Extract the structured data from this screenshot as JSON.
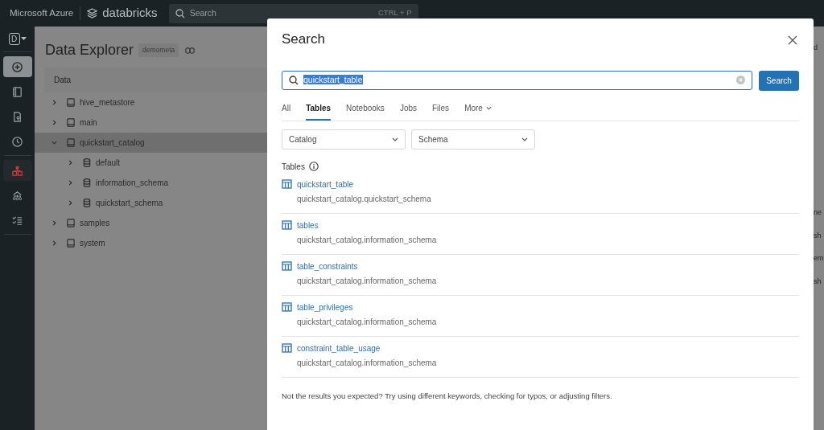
{
  "topbar": {
    "brand": "Microsoft Azure",
    "product": "databricks",
    "search": {
      "placeholder": "Search",
      "shortcut": "CTRL + P"
    }
  },
  "sidebar": {
    "workspace": "D",
    "items": [
      {
        "kind": "new",
        "selected": false
      },
      {
        "kind": "workspace",
        "selected": false
      },
      {
        "kind": "repos",
        "selected": false
      },
      {
        "kind": "recents",
        "selected": false
      },
      {
        "kind": "catalog",
        "selected": true
      },
      {
        "kind": "workflows",
        "selected": false
      },
      {
        "kind": "jobs",
        "selected": false
      }
    ]
  },
  "explorer": {
    "title": "Data Explorer",
    "badge": "demometa",
    "header": "Data",
    "tree": [
      {
        "label": "hive_metastore",
        "kind": "catalog",
        "expanded": false,
        "selected": false
      },
      {
        "label": "main",
        "kind": "catalog",
        "expanded": false,
        "selected": false
      },
      {
        "label": "quickstart_catalog",
        "kind": "catalog",
        "expanded": true,
        "selected": true,
        "children": [
          {
            "label": "default",
            "kind": "schema",
            "expanded": false,
            "selected": false
          },
          {
            "label": "information_schema",
            "kind": "schema",
            "expanded": false,
            "selected": false
          },
          {
            "label": "quickstart_schema",
            "kind": "schema",
            "expanded": false,
            "selected": false
          }
        ]
      },
      {
        "label": "samples",
        "kind": "catalog",
        "expanded": false,
        "selected": false
      },
      {
        "label": "system",
        "kind": "catalog",
        "expanded": false,
        "selected": false
      }
    ]
  },
  "background_fragments": [
    "d",
    "ne",
    "sh",
    "em",
    "sh"
  ],
  "modal": {
    "title": "Search",
    "query": {
      "value": "quickstart_table",
      "text_selected": true
    },
    "search_button": "Search",
    "tabs": [
      {
        "label": "All",
        "selected": false
      },
      {
        "label": "Tables",
        "selected": true
      },
      {
        "label": "Notebooks",
        "selected": false
      },
      {
        "label": "Jobs",
        "selected": false
      },
      {
        "label": "Files",
        "selected": false
      },
      {
        "label": "More",
        "selected": false,
        "kind": "dropdown"
      }
    ],
    "filters": [
      {
        "placeholder": "Catalog"
      },
      {
        "placeholder": "Schema"
      }
    ],
    "section": "Tables",
    "results": [
      {
        "name": "quickstart_table",
        "path": "quickstart_catalog.quickstart_schema"
      },
      {
        "name": "tables",
        "path": "quickstart_catalog.information_schema"
      },
      {
        "name": "table_constraints",
        "path": "quickstart_catalog.information_schema"
      },
      {
        "name": "table_privileges",
        "path": "quickstart_catalog.information_schema"
      },
      {
        "name": "constraint_table_usage",
        "path": "quickstart_catalog.information_schema"
      }
    ],
    "note": "Not the results you expected? Try using different keywords, checking for typos, or adjusting filters."
  }
}
